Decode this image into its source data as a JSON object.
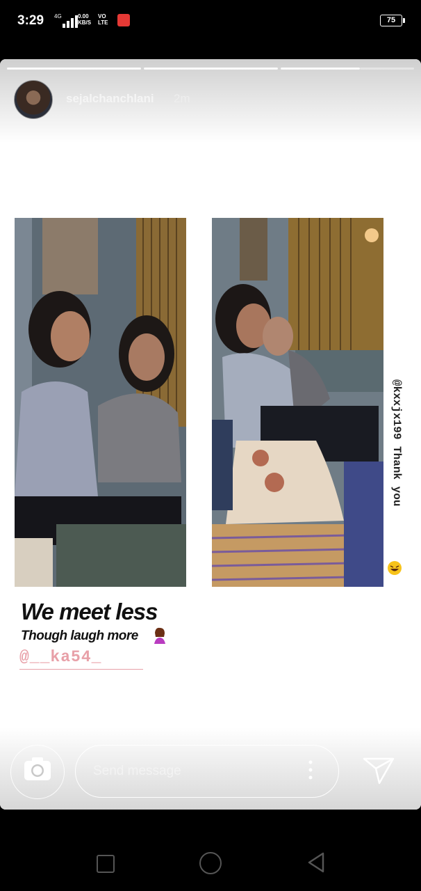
{
  "status_bar": {
    "time": "3:29",
    "network_gen": "4G",
    "data_speed_value": "0.00",
    "data_speed_unit": "KB/S",
    "volte_top": "VO",
    "volte_bottom": "LTE",
    "battery_level": "75"
  },
  "story": {
    "progress_segments": 3,
    "username": "sejalchanchlani",
    "time_ago": "2m",
    "sticker_tag_vertical": "@kxxjx199  Thank you",
    "caption_line1": "We meet less",
    "caption_line2": "Though laugh more",
    "mention": "@__ka54_"
  },
  "composer": {
    "placeholder": "Send message"
  },
  "icons": {
    "camera": "camera-icon",
    "more": "more-vertical-icon",
    "send": "send-icon",
    "recent": "recent-apps-icon",
    "home": "home-icon",
    "back": "back-icon"
  },
  "colors": {
    "mention": "#e8a0a8",
    "caption": "#111111",
    "status_app_icon": "#e53935"
  }
}
